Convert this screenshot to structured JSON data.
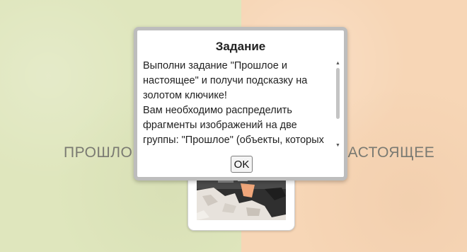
{
  "groups": {
    "past_label": "ПРОШЛОЕ",
    "present_label": "НАСТОЯЩЕЕ"
  },
  "dialog": {
    "title": "Задание",
    "body_lines": [
      "Выполни задание \"Прошлое и настоящее\" и получи подсказку на золотом ключике!",
      "Вам необходимо распределить фрагменты изображений на две группы: \"Прошлое\" (объекты, которых"
    ],
    "ok_label": "OK"
  },
  "colors": {
    "past_background": "#dfe6bd",
    "present_background": "#f7d6b6"
  }
}
